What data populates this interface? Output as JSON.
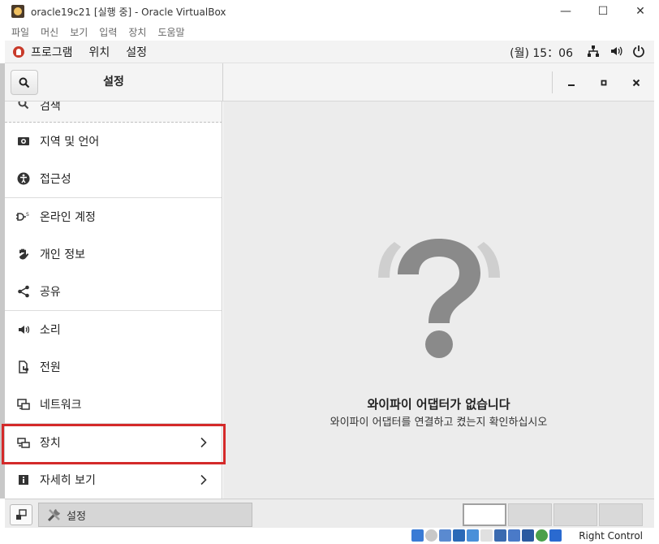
{
  "window": {
    "title": "oracle19c21 [실행 중] - Oracle VirtualBox",
    "minimize": "—",
    "maximize": "☐",
    "close": "✕"
  },
  "menubar": [
    "파일",
    "머신",
    "보기",
    "입력",
    "장치",
    "도움말"
  ],
  "gnome_bar": {
    "menus": [
      "프로그램",
      "위치",
      "설정"
    ],
    "clock": "(월) 15：06",
    "tray_icons": [
      "network-icon",
      "volume-icon",
      "power-icon"
    ]
  },
  "settings": {
    "title": "설정",
    "partial_item": {
      "label": "검색",
      "icon": "search-icon"
    },
    "items": [
      {
        "label": "지역 및 언어",
        "icon": "region-icon",
        "chevron": false
      },
      {
        "label": "접근성",
        "icon": "accessibility-icon",
        "chevron": false
      },
      {
        "label": "온라인 계정",
        "icon": "online-accounts-icon",
        "chevron": false
      },
      {
        "label": "개인 정보",
        "icon": "privacy-hand-icon",
        "chevron": false
      },
      {
        "label": "공유",
        "icon": "share-icon",
        "chevron": false
      },
      {
        "label": "소리",
        "icon": "sound-icon",
        "chevron": false
      },
      {
        "label": "전원",
        "icon": "power-plug-icon",
        "chevron": false
      },
      {
        "label": "네트워크",
        "icon": "network-icon",
        "chevron": false
      },
      {
        "label": "장치",
        "icon": "devices-icon",
        "chevron": true,
        "highlighted": true
      },
      {
        "label": "자세히 보기",
        "icon": "info-icon",
        "chevron": true
      }
    ],
    "empty_state": {
      "title": "와이파이 어댑터가 없습니다",
      "subtitle": "와이파이 어댑터를 연결하고 켰는지 확인하십시오",
      "icon": "wifi-question-icon"
    }
  },
  "bottom_panel": {
    "task_label": "설정",
    "workspaces": 4,
    "active_workspace": 1
  },
  "statusbar": {
    "host_key": "Right Control"
  },
  "colors": {
    "highlight": "#d42a2a",
    "content_bg": "#ececec",
    "icon_gray": "#888888"
  }
}
